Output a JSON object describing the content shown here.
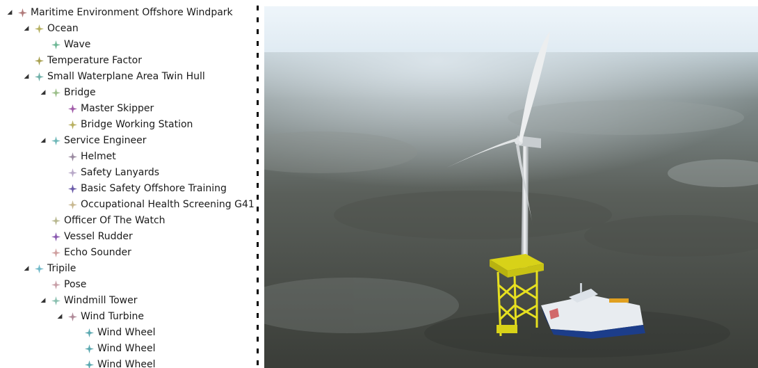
{
  "tree": {
    "items": [
      {
        "label": "Maritime Environment Offshore Windpark",
        "depth": 0,
        "expanded": true,
        "color": "#b07a7a"
      },
      {
        "label": "Ocean",
        "depth": 1,
        "expanded": true,
        "color": "#b5b060"
      },
      {
        "label": "Wave",
        "depth": 2,
        "expanded": null,
        "color": "#6fb896"
      },
      {
        "label": "Temperature Factor",
        "depth": 1,
        "expanded": null,
        "color": "#a8a050"
      },
      {
        "label": "Small Waterplane Area Twin Hull",
        "depth": 1,
        "expanded": true,
        "color": "#6fb0a8"
      },
      {
        "label": "Bridge",
        "depth": 2,
        "expanded": true,
        "color": "#9cbf8a"
      },
      {
        "label": "Master Skipper",
        "depth": 3,
        "expanded": null,
        "color": "#a05aa8"
      },
      {
        "label": "Bridge Working Station",
        "depth": 3,
        "expanded": null,
        "color": "#b8b060"
      },
      {
        "label": "Service Engineer",
        "depth": 2,
        "expanded": true,
        "color": "#6fb8b8"
      },
      {
        "label": "Helmet",
        "depth": 3,
        "expanded": null,
        "color": "#9a8aa0"
      },
      {
        "label": "Safety Lanyards",
        "depth": 3,
        "expanded": null,
        "color": "#b8a8c8"
      },
      {
        "label": "Basic Safety Offshore Training",
        "depth": 3,
        "expanded": null,
        "color": "#6a5aa8"
      },
      {
        "label": "Occupational Health Screening G41",
        "depth": 3,
        "expanded": null,
        "color": "#c8b890"
      },
      {
        "label": "Officer Of The Watch",
        "depth": 2,
        "expanded": null,
        "color": "#b8b890"
      },
      {
        "label": "Vessel Rudder",
        "depth": 2,
        "expanded": null,
        "color": "#8a5ab0"
      },
      {
        "label": "Echo Sounder",
        "depth": 2,
        "expanded": null,
        "color": "#d0a0a0"
      },
      {
        "label": "Tripile",
        "depth": 1,
        "expanded": true,
        "color": "#6fb8c8"
      },
      {
        "label": "Pose",
        "depth": 2,
        "expanded": null,
        "color": "#c8a0a8"
      },
      {
        "label": "Windmill Tower",
        "depth": 2,
        "expanded": true,
        "color": "#8ac0b0"
      },
      {
        "label": "Wind Turbine",
        "depth": 3,
        "expanded": true,
        "color": "#b08a98"
      },
      {
        "label": "Wind Wheel",
        "depth": 4,
        "expanded": null,
        "color": "#5aa8b0"
      },
      {
        "label": "Wind Wheel",
        "depth": 4,
        "expanded": null,
        "color": "#5aa8b0"
      },
      {
        "label": "Wind Wheel",
        "depth": 4,
        "expanded": null,
        "color": "#5aa8b0"
      }
    ]
  },
  "scene": {
    "colors": {
      "sky": "#e8f2f8",
      "sea_dark": "#3a3a36",
      "sea_mid": "#6e7574",
      "foundation": "#e6e020",
      "vessel_hull": "#1c3d8a",
      "vessel_deck": "#e8ecf0"
    },
    "icons": [
      "wind-turbine-icon",
      "tripile-foundation-icon",
      "service-vessel-icon"
    ]
  }
}
